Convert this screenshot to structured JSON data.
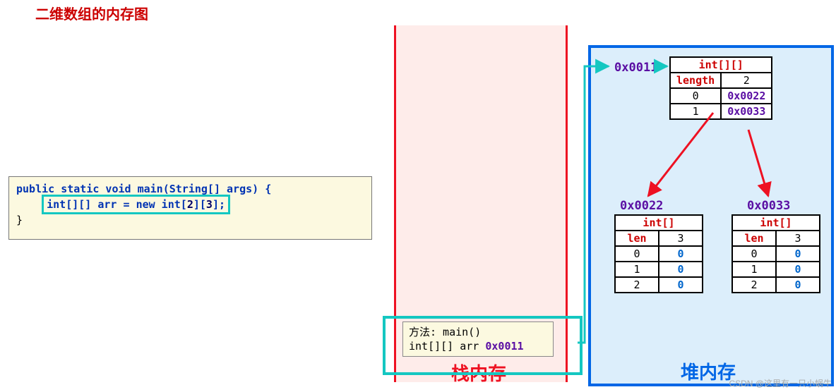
{
  "title": "二维数组的内存图",
  "code": {
    "line1_pre": "public static void main(String[] args) {",
    "decl_pre": "int[][] arr = ",
    "decl_new": "new int[",
    "decl_a": "2",
    "decl_mid": "][",
    "decl_b": "3",
    "decl_end": "];",
    "line3": "}"
  },
  "stack": {
    "label": "栈内存",
    "frame_l1": "方法: main()",
    "frame_l2_pre": "int[][] arr  ",
    "frame_l2_addr": "0x0011"
  },
  "heap": {
    "label": "堆内存",
    "addr_top": "0x0011",
    "outer": {
      "type": "int[][]",
      "len_lbl": "length",
      "len_val": "2",
      "rows": [
        {
          "idx": "0",
          "val": "0x0022"
        },
        {
          "idx": "1",
          "val": "0x0033"
        }
      ]
    },
    "inner": [
      {
        "addr": "0x0022",
        "type": "int[]",
        "len_lbl": "len",
        "len_val": "3",
        "rows": [
          {
            "idx": "0",
            "val": "0"
          },
          {
            "idx": "1",
            "val": "0"
          },
          {
            "idx": "2",
            "val": "0"
          }
        ]
      },
      {
        "addr": "0x0033",
        "type": "int[]",
        "len_lbl": "len",
        "len_val": "3",
        "rows": [
          {
            "idx": "0",
            "val": "0"
          },
          {
            "idx": "1",
            "val": "0"
          },
          {
            "idx": "2",
            "val": "0"
          }
        ]
      }
    ]
  },
  "watermark": "CSDN @这里有一只小蜗牛",
  "chart_data": {
    "type": "diagram",
    "title": "二维数组的内存图",
    "source_code": "public static void main(String[] args) { int[][] arr = new int[2][3]; }",
    "stack": [
      {
        "method": "main()",
        "var": "int[][] arr",
        "value": "0x0011"
      }
    ],
    "heap_objects": [
      {
        "address": "0x0011",
        "type": "int[][]",
        "length": 2,
        "slots": {
          "0": "0x0022",
          "1": "0x0033"
        }
      },
      {
        "address": "0x0022",
        "type": "int[]",
        "length": 3,
        "slots": {
          "0": 0,
          "1": 0,
          "2": 0
        }
      },
      {
        "address": "0x0033",
        "type": "int[]",
        "length": 3,
        "slots": {
          "0": 0,
          "1": 0,
          "2": 0
        }
      }
    ],
    "pointers": [
      {
        "from": "stack.arr",
        "to": "0x0011"
      },
      {
        "from": "0x0011[0]",
        "to": "0x0022"
      },
      {
        "from": "0x0011[1]",
        "to": "0x0033"
      }
    ]
  }
}
